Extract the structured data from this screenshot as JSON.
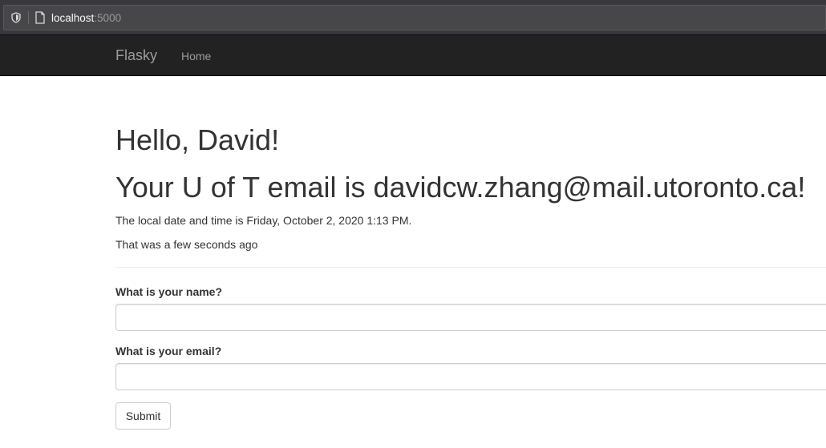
{
  "browser": {
    "url_host": "localhost",
    "url_port": ":5000",
    "icons": [
      "shield-icon",
      "page-icon"
    ]
  },
  "navbar": {
    "brand": "Flasky",
    "items": [
      {
        "label": "Home"
      }
    ]
  },
  "main": {
    "greeting": "Hello, David!",
    "email_heading": "Your U of T email is davidcw.zhang@mail.utoronto.ca!",
    "local_time_text": "The local date and time is Friday, October 2, 2020 1:13 PM.",
    "relative_time_text": "That was a few seconds ago"
  },
  "form": {
    "name_label": "What is your name?",
    "name_value": "",
    "email_label": "What is your email?",
    "email_value": "",
    "submit_label": "Submit"
  }
}
